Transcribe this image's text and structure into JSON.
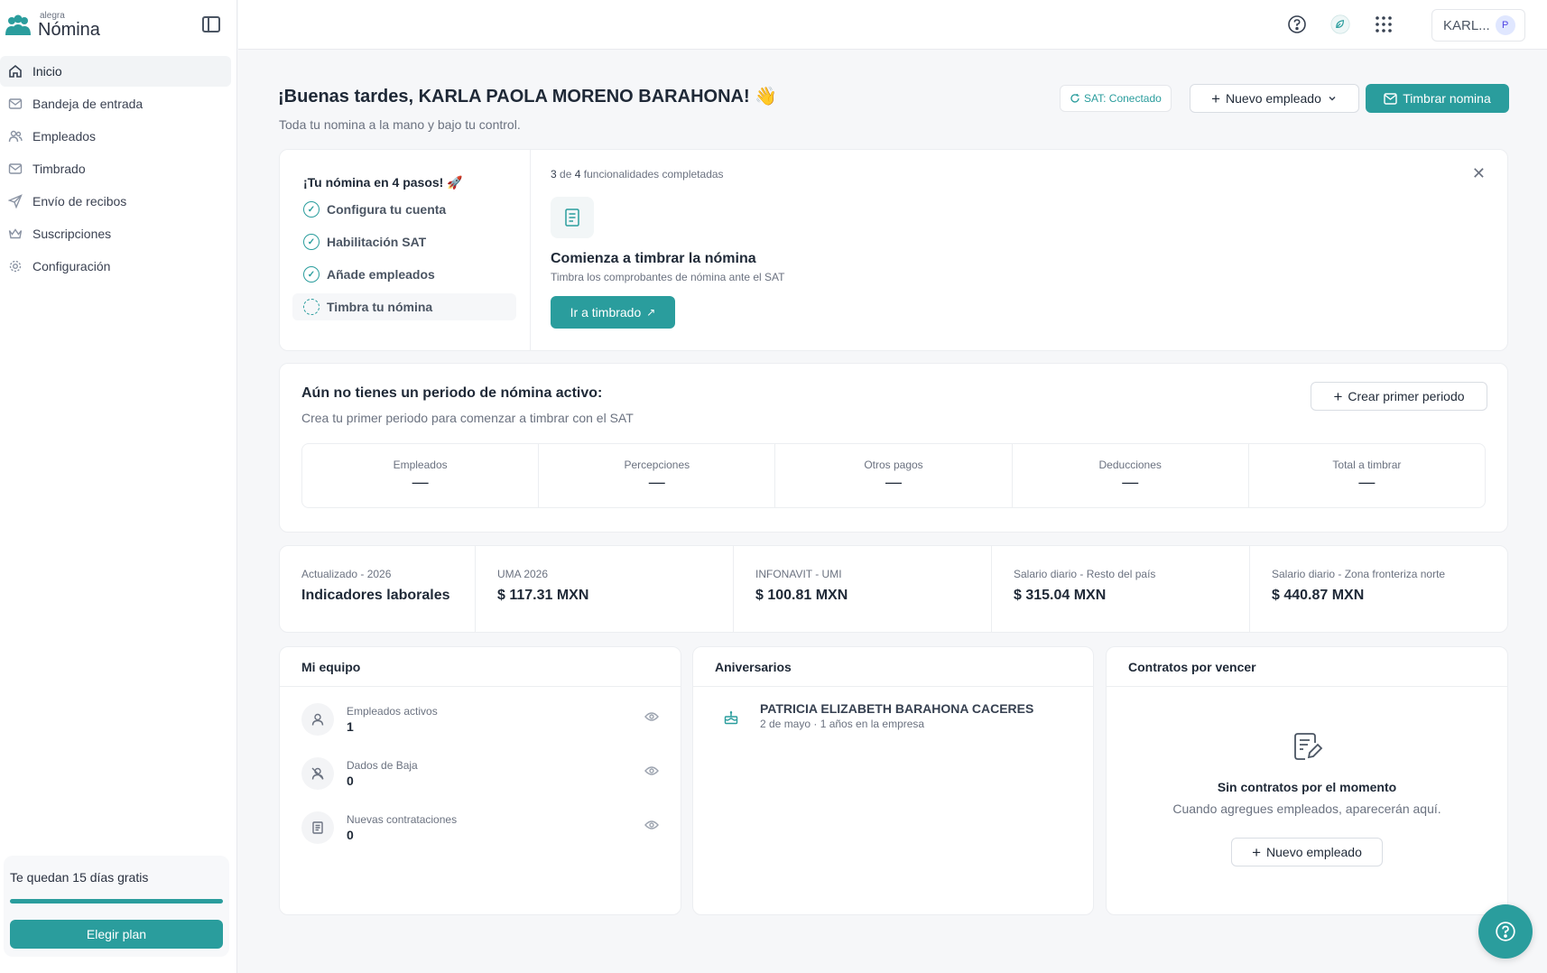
{
  "brand": {
    "small": "alegra",
    "name": "Nómina"
  },
  "sidebar": {
    "items": [
      {
        "label": "Inicio",
        "icon": "home-icon",
        "active": true
      },
      {
        "label": "Bandeja de entrada",
        "icon": "inbox-icon"
      },
      {
        "label": "Empleados",
        "icon": "users-icon"
      },
      {
        "label": "Timbrado",
        "icon": "mail-icon"
      },
      {
        "label": "Envío de recibos",
        "icon": "send-icon"
      },
      {
        "label": "Suscripciones",
        "icon": "crown-icon"
      },
      {
        "label": "Configuración",
        "icon": "gear-icon"
      }
    ],
    "trial": {
      "text": "Te quedan 15 días gratis",
      "progress": 1.0,
      "button": "Elegir plan"
    }
  },
  "topbar": {
    "user": "KARL...",
    "avatar": "P"
  },
  "header": {
    "greeting": "¡Buenas tardes, KARLA PAOLA MORENO BARAHONA! 👋",
    "subtitle": "Toda tu nomina a la mano y bajo tu control.",
    "sat_status": "SAT: Conectado",
    "new_employee": "Nuevo empleado",
    "stamp_payroll": "Timbrar nomina"
  },
  "steps": {
    "title": "¡Tu nómina en 4 pasos! 🚀",
    "items": [
      {
        "label": "Configura tu cuenta",
        "done": true
      },
      {
        "label": "Habilitación SAT",
        "done": true
      },
      {
        "label": "Añade empleados",
        "done": true
      },
      {
        "label": "Timbra tu nómina",
        "done": false
      }
    ],
    "completed": "3",
    "total": "4",
    "progress_suffix": "funcionalidades completadas",
    "of": "de",
    "feature_title": "Comienza a timbrar la nómina",
    "feature_desc": "Timbra los comprobantes de nómina ante el SAT",
    "feature_button": "Ir a timbrado"
  },
  "period": {
    "title": "Aún no tienes un periodo de nómina activo:",
    "desc": "Crea tu primer periodo para comenzar a timbrar con el SAT",
    "create_button": "Crear primer periodo",
    "stats": [
      {
        "label": "Empleados",
        "value": "—"
      },
      {
        "label": "Percepciones",
        "value": "—"
      },
      {
        "label": "Otros pagos",
        "value": "—"
      },
      {
        "label": "Deducciones",
        "value": "—"
      },
      {
        "label": "Total a timbrar",
        "value": "—"
      }
    ]
  },
  "indicators": [
    {
      "label": "Actualizado - 2026",
      "value": "Indicadores laborales"
    },
    {
      "label": "UMA 2026",
      "value": "$ 117.31 MXN"
    },
    {
      "label": "INFONAVIT - UMI",
      "value": "$ 100.81 MXN"
    },
    {
      "label": "Salario diario - Resto del país",
      "value": "$ 315.04 MXN"
    },
    {
      "label": "Salario diario - Zona fronteriza norte",
      "value": "$ 440.87 MXN"
    }
  ],
  "team": {
    "title": "Mi equipo",
    "rows": [
      {
        "label": "Empleados activos",
        "value": "1"
      },
      {
        "label": "Dados de Baja",
        "value": "0"
      },
      {
        "label": "Nuevas contrataciones",
        "value": "0"
      }
    ]
  },
  "anniversaries": {
    "title": "Aniversarios",
    "items": [
      {
        "name": "PATRICIA ELIZABETH BARAHONA CACERES",
        "detail": "2 de mayo · 1 años en la empresa"
      }
    ]
  },
  "contracts": {
    "title": "Contratos por vencer",
    "empty_title": "Sin contratos por el momento",
    "empty_desc": "Cuando agregues empleados, aparecerán aquí.",
    "button": "Nuevo empleado"
  },
  "colors": {
    "accent": "#2a9d9d"
  }
}
